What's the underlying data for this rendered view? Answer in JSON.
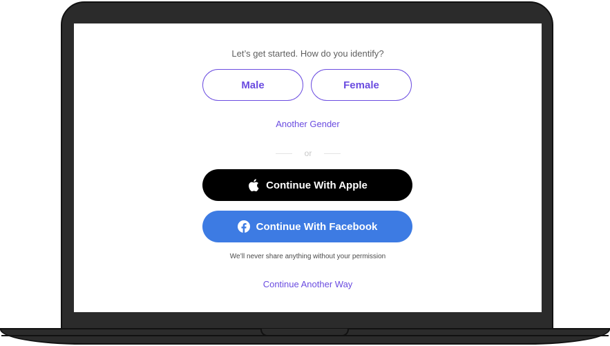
{
  "onboarding": {
    "prompt": "Let’s get started. How do you identify?",
    "gender_options": {
      "male": "Male",
      "female": "Female",
      "another": "Another Gender"
    },
    "divider_text": "or",
    "apple_button": {
      "label": "Continue With Apple",
      "icon": "apple-icon",
      "background": "#000000"
    },
    "facebook_button": {
      "label": "Continue With Facebook",
      "icon": "facebook-icon",
      "background": "#3d7be3"
    },
    "privacy_note": "We’ll never share anything without your permission",
    "continue_another_way": "Continue Another Way"
  },
  "colors": {
    "accent": "#6a4be0",
    "laptop_frame": "#2b2b2b"
  }
}
